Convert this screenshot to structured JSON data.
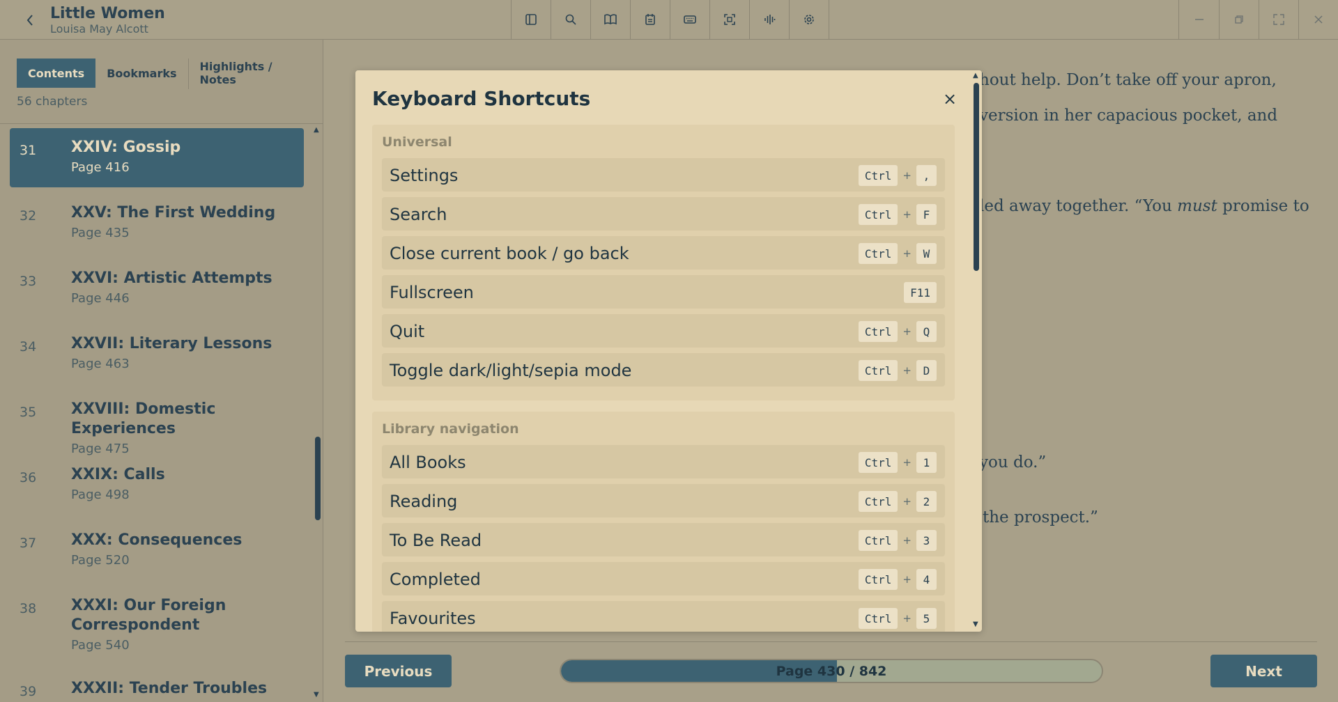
{
  "header": {
    "title": "Little Women",
    "author": "Louisa May Alcott",
    "toolbar_icons": [
      "sidebar-icon",
      "search-icon",
      "book-icon",
      "calendar-icon",
      "keyboard-icon",
      "focus-icon",
      "audio-icon",
      "settings-icon"
    ],
    "window_icons": [
      "minimize-icon",
      "restore-icon",
      "fullscreen-icon",
      "close-icon"
    ]
  },
  "sidebar": {
    "tabs": [
      "Contents",
      "Bookmarks",
      "Highlights / Notes"
    ],
    "active_tab": "Contents",
    "chapter_count": "56 chapters",
    "chapters": [
      {
        "num": "31",
        "title": "XXIV: Gossip",
        "page": "Page 416",
        "active": true
      },
      {
        "num": "32",
        "title": "XXV: The First Wedding",
        "page": "Page 435"
      },
      {
        "num": "33",
        "title": "XXVI: Artistic Attempts",
        "page": "Page 446"
      },
      {
        "num": "34",
        "title": "XXVII: Literary Lessons",
        "page": "Page 463"
      },
      {
        "num": "35",
        "title": "XXVIII: Domestic Experiences",
        "page": "Page 475"
      },
      {
        "num": "36",
        "title": "XXIX: Calls",
        "page": "Page 498"
      },
      {
        "num": "37",
        "title": "XXX: Consequences",
        "page": "Page 520"
      },
      {
        "num": "38",
        "title": "XXXI: Our Foreign Correspondent",
        "page": "Page 540"
      },
      {
        "num": "39",
        "title": "XXXII: Tender Troubles",
        "page": ""
      }
    ]
  },
  "reader": {
    "line1": "hout help. Don’t take off your apron,",
    "line2": "version in her capacious pocket, and",
    "line3_pre": "led away together. “You ",
    "line3_em": "must",
    "line3_post": " promise to",
    "line4": "you do.”",
    "line5": "the prospect.”"
  },
  "nav": {
    "previous": "Previous",
    "next": "Next",
    "page_label": "Page 430 / 842",
    "progress": 0.51
  },
  "modal": {
    "title": "Keyboard Shortcuts",
    "close": "×",
    "sections": [
      {
        "title": "Universal",
        "rows": [
          {
            "label": "Settings",
            "keys": [
              "Ctrl",
              ","
            ]
          },
          {
            "label": "Search",
            "keys": [
              "Ctrl",
              "F"
            ]
          },
          {
            "label": "Close current book / go back",
            "keys": [
              "Ctrl",
              "W"
            ]
          },
          {
            "label": "Fullscreen",
            "keys": [
              "F11"
            ]
          },
          {
            "label": "Quit",
            "keys": [
              "Ctrl",
              "Q"
            ]
          },
          {
            "label": "Toggle dark/light/sepia mode",
            "keys": [
              "Ctrl",
              "D"
            ]
          }
        ]
      },
      {
        "title": "Library navigation",
        "rows": [
          {
            "label": "All Books",
            "keys": [
              "Ctrl",
              "1"
            ]
          },
          {
            "label": "Reading",
            "keys": [
              "Ctrl",
              "2"
            ]
          },
          {
            "label": "To Be Read",
            "keys": [
              "Ctrl",
              "3"
            ]
          },
          {
            "label": "Completed",
            "keys": [
              "Ctrl",
              "4"
            ]
          },
          {
            "label": "Favourites",
            "keys": [
              "Ctrl",
              "5"
            ]
          }
        ]
      }
    ],
    "plus": "+"
  },
  "colors": {
    "accent": "#3d6272",
    "background": "#a8a089",
    "modal": "#e7d8b6"
  }
}
